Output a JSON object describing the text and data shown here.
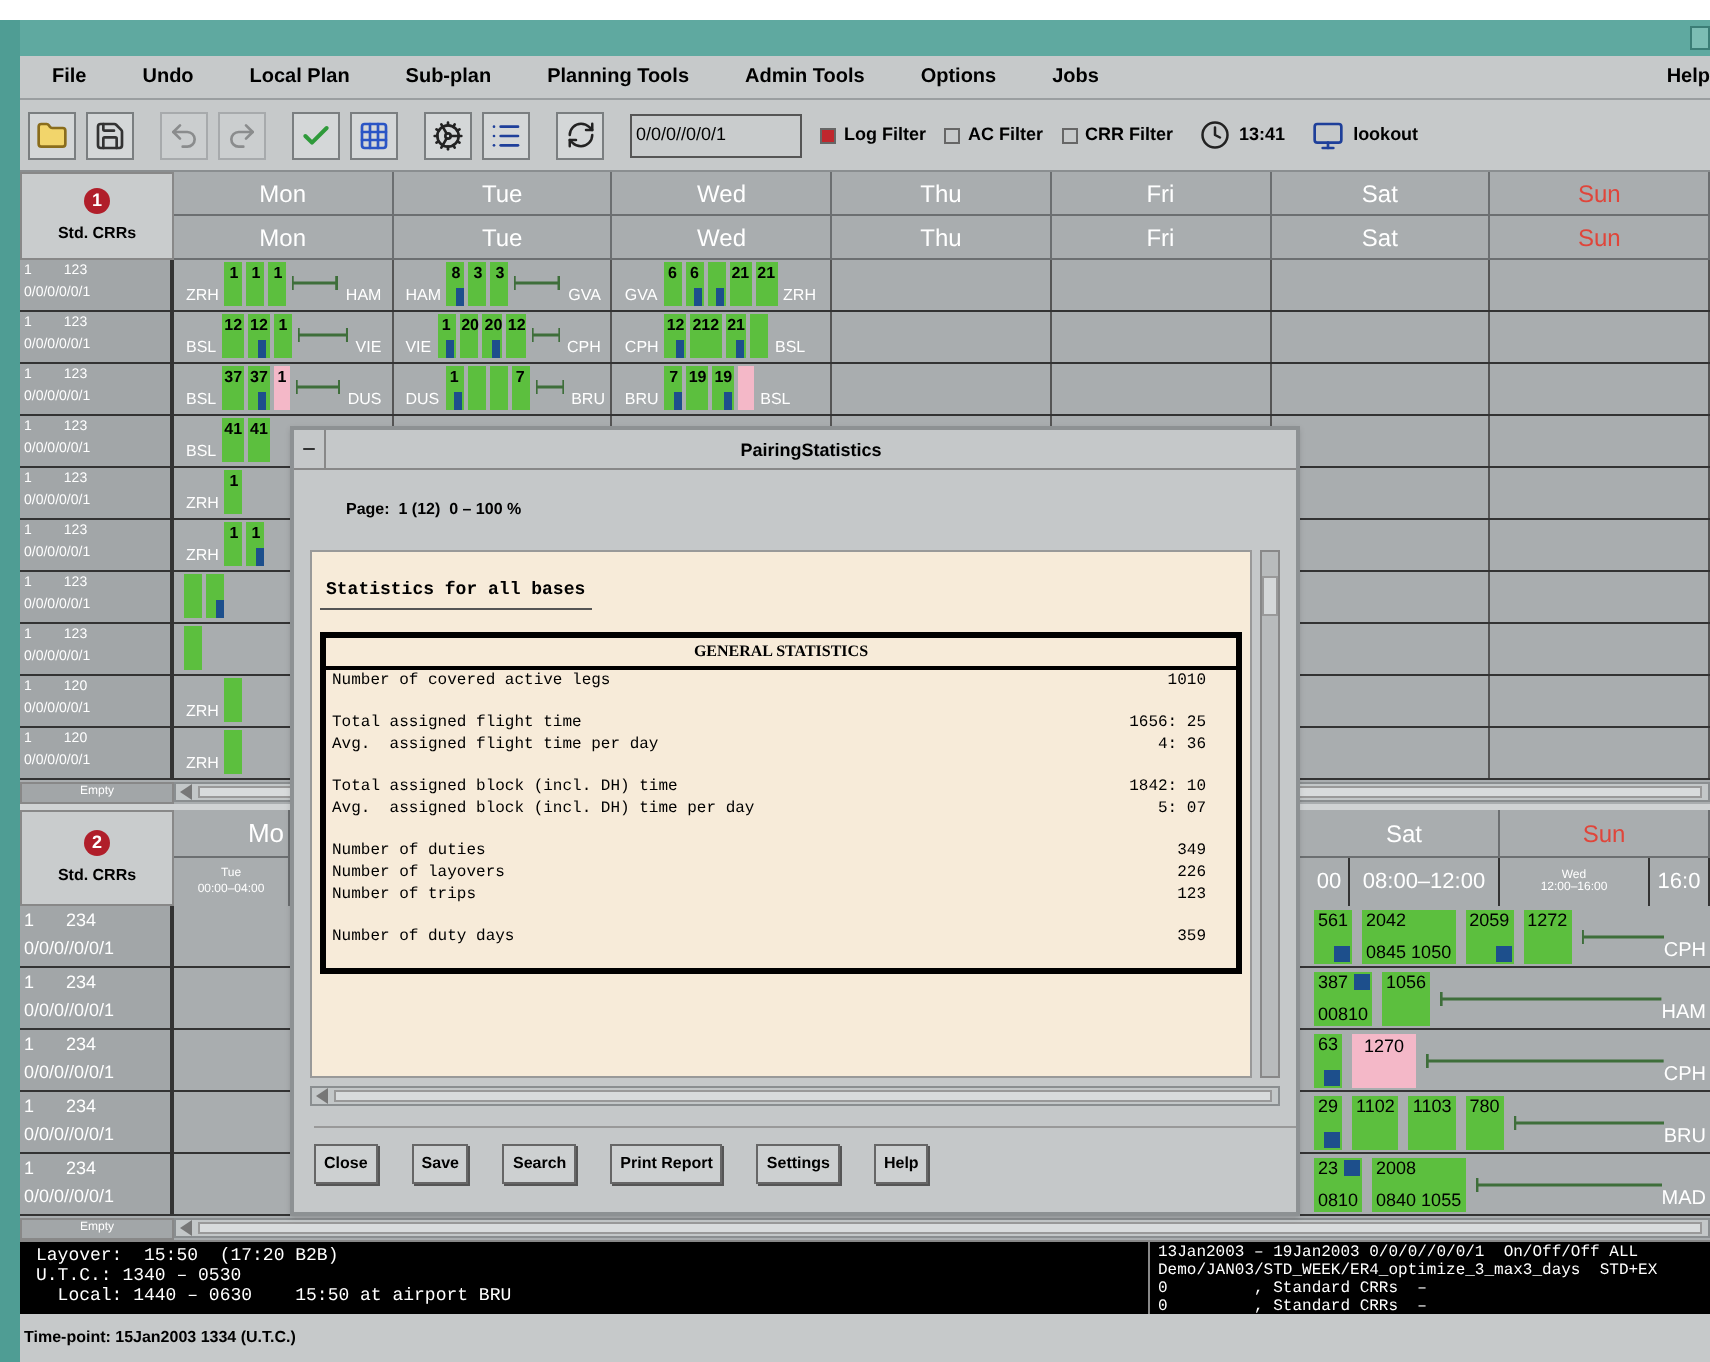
{
  "menu": [
    {
      "label": "File"
    },
    {
      "label": "Undo"
    },
    {
      "label": "Local Plan"
    },
    {
      "label": "Sub-plan"
    },
    {
      "label": "Planning Tools"
    },
    {
      "label": "Admin Tools"
    },
    {
      "label": "Options"
    },
    {
      "label": "Jobs"
    },
    {
      "label": "Help"
    }
  ],
  "toolbar": {
    "buttons": [
      {
        "kind": "open",
        "disabled": false
      },
      {
        "kind": "save",
        "disabled": false
      },
      {
        "kind": "undo",
        "disabled": true
      },
      {
        "kind": "redo",
        "disabled": true
      },
      {
        "kind": "check",
        "disabled": false
      },
      {
        "kind": "grid",
        "disabled": false
      },
      {
        "kind": "gear",
        "disabled": false
      },
      {
        "kind": "list",
        "disabled": false
      },
      {
        "kind": "refresh",
        "disabled": false
      }
    ],
    "field_value": "0/0/0//0/0/1",
    "filters": [
      {
        "label": "Log Filter",
        "checked": true
      },
      {
        "label": "AC Filter",
        "checked": false
      },
      {
        "label": "CRR Filter",
        "checked": false
      }
    ],
    "clock": "13:41",
    "user": "lookout"
  },
  "upper_pane": {
    "badge": "1",
    "title": "Std. CRRs",
    "empty_label": "Empty",
    "header_rows": [
      [
        {
          "label": "Mon",
          "highlight": false
        },
        {
          "label": "Tue",
          "highlight": false
        },
        {
          "label": "Wed",
          "highlight": false
        },
        {
          "label": "Thu",
          "highlight": false
        },
        {
          "label": "Fri",
          "highlight": false
        },
        {
          "label": "Sat",
          "highlight": false
        },
        {
          "label": "Sun",
          "highlight": true
        }
      ],
      [
        {
          "label": "Mon",
          "highlight": false
        },
        {
          "label": "Tue",
          "highlight": false
        },
        {
          "label": "Wed",
          "highlight": false
        },
        {
          "label": "Thu",
          "highlight": false
        },
        {
          "label": "Fri",
          "highlight": false
        },
        {
          "label": "Sat",
          "highlight": false
        },
        {
          "label": "Sun",
          "highlight": true
        }
      ]
    ],
    "rows": [
      {
        "id": "1",
        "count": "123",
        "code": "0/0/0/0/0/1",
        "days": [
          [
            {
              "kind": "station",
              "text": "ZRH"
            },
            {
              "kind": "leg",
              "label": "1",
              "marker": false
            },
            {
              "kind": "leg",
              "label": "1",
              "marker": false
            },
            {
              "kind": "leg",
              "label": "1",
              "marker": false
            },
            {
              "kind": "layover"
            },
            {
              "kind": "station",
              "text": "HAM"
            }
          ],
          [
            {
              "kind": "station",
              "text": "HAM"
            },
            {
              "kind": "leg",
              "label": "8",
              "marker": true
            },
            {
              "kind": "leg",
              "label": "3",
              "marker": false
            },
            {
              "kind": "leg",
              "label": "3",
              "marker": false
            },
            {
              "kind": "layover"
            },
            {
              "kind": "station",
              "text": "GVA"
            }
          ],
          [
            {
              "kind": "station",
              "text": "GVA"
            },
            {
              "kind": "leg",
              "label": "6",
              "marker": false
            },
            {
              "kind": "leg",
              "label": "6",
              "marker": true
            },
            {
              "kind": "leg",
              "marker": true
            },
            {
              "kind": "leg",
              "label": "21",
              "marker": false
            },
            {
              "kind": "leg",
              "label": "21",
              "marker": false
            },
            {
              "kind": "station",
              "text": "ZRH"
            }
          ]
        ]
      },
      {
        "id": "1",
        "count": "123",
        "code": "0/0/0/0/0/1",
        "days": [
          [
            {
              "kind": "station",
              "text": "BSL"
            },
            {
              "kind": "leg",
              "label": "12",
              "marker": false
            },
            {
              "kind": "leg",
              "label": "12",
              "marker": true
            },
            {
              "kind": "leg",
              "label": "1",
              "marker": false
            },
            {
              "kind": "layover"
            },
            {
              "kind": "station",
              "text": "VIE"
            }
          ],
          [
            {
              "kind": "station",
              "text": "VIE"
            },
            {
              "kind": "leg",
              "label": "1",
              "marker": true
            },
            {
              "kind": "leg",
              "label": "20",
              "marker": false
            },
            {
              "kind": "leg",
              "label": "20",
              "marker": true
            },
            {
              "kind": "leg",
              "label": "12",
              "marker": false
            },
            {
              "kind": "layover"
            },
            {
              "kind": "station",
              "text": "CPH"
            }
          ],
          [
            {
              "kind": "station",
              "text": "CPH"
            },
            {
              "kind": "leg",
              "label": "12",
              "marker": true
            },
            {
              "kind": "leg",
              "label": "212",
              "marker": false
            },
            {
              "kind": "leg",
              "label": "21",
              "marker": true
            },
            {
              "kind": "leg",
              "marker": false
            },
            {
              "kind": "station",
              "text": "BSL"
            }
          ]
        ]
      },
      {
        "id": "1",
        "count": "123",
        "code": "0/0/0/0/0/1",
        "days": [
          [
            {
              "kind": "station",
              "text": "BSL"
            },
            {
              "kind": "leg",
              "label": "37",
              "marker": false
            },
            {
              "kind": "leg",
              "label": "37",
              "marker": true
            },
            {
              "kind": "deadhead",
              "label": "1"
            },
            {
              "kind": "layover"
            },
            {
              "kind": "station",
              "text": "DUS"
            }
          ],
          [
            {
              "kind": "station",
              "text": "DUS"
            },
            {
              "kind": "leg",
              "label": "1",
              "marker": true
            },
            {
              "kind": "leg",
              "marker": false
            },
            {
              "kind": "leg",
              "marker": false
            },
            {
              "kind": "leg",
              "label": "7",
              "marker": false
            },
            {
              "kind": "layover"
            },
            {
              "kind": "station",
              "text": "BRU"
            }
          ],
          [
            {
              "kind": "station",
              "text": "BRU"
            },
            {
              "kind": "leg",
              "label": "7",
              "marker": true
            },
            {
              "kind": "leg",
              "label": "19",
              "marker": false
            },
            {
              "kind": "leg",
              "label": "19",
              "marker": true
            },
            {
              "kind": "deadhead"
            },
            {
              "kind": "station",
              "text": "BSL"
            }
          ]
        ]
      },
      {
        "id": "1",
        "count": "123",
        "code": "0/0/0/0/0/1",
        "days": [
          [
            {
              "kind": "station",
              "text": "BSL"
            },
            {
              "kind": "leg",
              "label": "41",
              "marker": false
            },
            {
              "kind": "leg",
              "label": "41",
              "marker": false
            }
          ]
        ]
      },
      {
        "id": "1",
        "count": "123",
        "code": "0/0/0/0/0/1",
        "days": [
          [
            {
              "kind": "station",
              "text": "ZRH"
            },
            {
              "kind": "leg",
              "label": "1",
              "marker": false
            }
          ]
        ]
      },
      {
        "id": "1",
        "count": "123",
        "code": "0/0/0/0/0/1",
        "days": [
          [
            {
              "kind": "station",
              "text": "ZRH"
            },
            {
              "kind": "leg",
              "label": "1",
              "marker": false
            },
            {
              "kind": "leg",
              "label": "1",
              "marker": true
            }
          ]
        ]
      },
      {
        "id": "1",
        "count": "123",
        "code": "0/0/0/0/0/1",
        "days": [
          [
            {
              "kind": "leg",
              "marker": false
            },
            {
              "kind": "leg",
              "marker": true
            }
          ]
        ]
      },
      {
        "id": "1",
        "count": "123",
        "code": "0/0/0/0/0/1",
        "days": [
          [
            {
              "kind": "leg",
              "marker": false
            }
          ]
        ]
      },
      {
        "id": "1",
        "count": "120",
        "code": "0/0/0/0/0/1",
        "days": [
          [
            {
              "kind": "station",
              "text": "ZRH"
            },
            {
              "kind": "leg",
              "marker": false
            }
          ]
        ]
      },
      {
        "id": "1",
        "count": "120",
        "code": "0/0/0/0/0/1",
        "days": [
          [
            {
              "kind": "station",
              "text": "ZRH"
            },
            {
              "kind": "leg",
              "marker": false
            }
          ]
        ]
      }
    ]
  },
  "lower_pane": {
    "badge": "2",
    "title": "Std. CRRs",
    "empty_label": "Empty",
    "left_day": "Mo",
    "left_time": {
      "day": "Tue",
      "range": "00:00–04:00"
    },
    "days": [
      {
        "label": "Sat",
        "highlight": false
      },
      {
        "label": "Sun",
        "highlight": true
      }
    ],
    "times": [
      {
        "range": "00"
      },
      {
        "range": "08:00–12:00"
      },
      {
        "day": "Wed",
        "range": "12:00–16:00"
      },
      {
        "range": "16:0"
      }
    ],
    "rows": [
      {
        "id": "1",
        "count": "234",
        "code": "0/0/0//0/0/1",
        "segments": [
          {
            "kind": "leg",
            "label": "561",
            "marker": true
          },
          {
            "kind": "leg",
            "label": "2042",
            "sub": "0845 1050",
            "marker": false
          },
          {
            "kind": "leg",
            "label": "2059",
            "marker": true
          },
          {
            "kind": "leg",
            "label": "1272",
            "marker": false
          },
          {
            "kind": "layover"
          },
          {
            "kind": "station",
            "text": "CPH"
          }
        ]
      },
      {
        "id": "1",
        "count": "234",
        "code": "0/0/0//0/0/1",
        "segments": [
          {
            "kind": "leg",
            "label": "387",
            "sub": "00810",
            "marker": true
          },
          {
            "kind": "leg",
            "label": "1056",
            "marker": false
          },
          {
            "kind": "layover"
          },
          {
            "kind": "station",
            "text": "HAM"
          }
        ]
      },
      {
        "id": "1",
        "count": "234",
        "code": "0/0/0//0/0/1",
        "segments": [
          {
            "kind": "leg",
            "label": "63",
            "marker": true
          },
          {
            "kind": "deadhead",
            "label": "1270"
          },
          {
            "kind": "layover"
          },
          {
            "kind": "station",
            "text": "CPH"
          }
        ]
      },
      {
        "id": "1",
        "count": "234",
        "code": "0/0/0//0/0/1",
        "segments": [
          {
            "kind": "leg",
            "label": "29",
            "marker": true
          },
          {
            "kind": "leg",
            "label": "1102",
            "marker": false
          },
          {
            "kind": "leg",
            "label": "1103",
            "marker": false
          },
          {
            "kind": "leg",
            "label": "780",
            "marker": false
          },
          {
            "kind": "layover"
          },
          {
            "kind": "station",
            "text": "BRU"
          }
        ]
      },
      {
        "id": "1",
        "count": "234",
        "code": "0/0/0//0/0/1",
        "segments": [
          {
            "kind": "leg",
            "label": "23",
            "sub": "0810",
            "marker": true
          },
          {
            "kind": "leg",
            "label": "2008",
            "sub": "0840 1055",
            "marker": false
          },
          {
            "kind": "layover"
          },
          {
            "kind": "station",
            "text": "MAD"
          }
        ]
      }
    ]
  },
  "dialog": {
    "title": "PairingStatistics",
    "page": "Page:  1 (12)  0 – 100 %",
    "report_title": "Statistics for all bases",
    "table_title": "GENERAL STATISTICS",
    "groups": [
      [
        {
          "label": "Number of covered active legs",
          "value": "1010"
        }
      ],
      [
        {
          "label": "Total assigned flight time",
          "value": "1656: 25"
        },
        {
          "label": "Avg.  assigned flight time per day",
          "value": "4: 36"
        }
      ],
      [
        {
          "label": "Total assigned block (incl. DH) time",
          "value": "1842: 10"
        },
        {
          "label": "Avg.  assigned block (incl. DH) time per day",
          "value": "5: 07"
        }
      ],
      [
        {
          "label": "Number of duties",
          "value": "349"
        },
        {
          "label": "Number of layovers",
          "value": "226"
        },
        {
          "label": "Number of trips",
          "value": "123"
        }
      ],
      [
        {
          "label": "Number of duty days",
          "value": "359"
        }
      ]
    ],
    "buttons": [
      {
        "label": "Close"
      },
      {
        "label": "Save"
      },
      {
        "label": "Search"
      },
      {
        "label": "Print Report"
      },
      {
        "label": "Settings"
      },
      {
        "label": "Help"
      }
    ]
  },
  "status": {
    "left": [
      "Layover:  15:50  (17:20 B2B)",
      "U.T.C.: 1340 – 0530",
      "  Local: 1440 – 0630    15:50 at airport BRU"
    ],
    "right": [
      "13Jan2003 – 19Jan2003 0/0/0//0/0/1  On/Off/Off ALL",
      "Demo/JAN03/STD_WEEK/ER4_optimize_3_max3_days  STD+EX",
      "0         , Standard CRRs  –",
      "0         , Standard CRRs  –"
    ]
  },
  "time_point": "Time-point: 15Jan2003 1334 (U.T.C.)"
}
